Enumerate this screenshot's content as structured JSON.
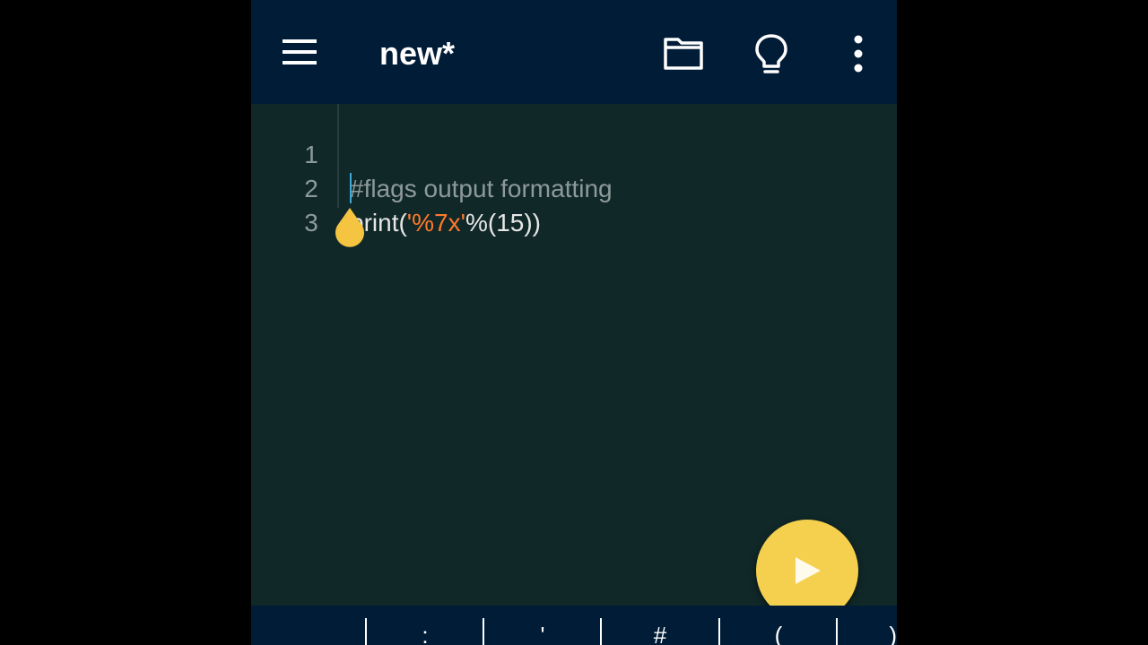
{
  "appbar": {
    "title": "new*",
    "icons": [
      "menu-icon",
      "folder-icon",
      "lightbulb-icon",
      "more-vert-icon"
    ]
  },
  "editor": {
    "lines": [
      {
        "number": "1",
        "text": "#flags output formatting"
      },
      {
        "number": "2",
        "segments": [
          "print(",
          "'%7x'",
          "%(15))"
        ]
      },
      {
        "number": "3",
        "text": ""
      }
    ]
  },
  "fab": {
    "icon": "play-icon"
  },
  "keybar": {
    "keys": [
      "",
      ":",
      "'",
      "#",
      "(",
      ")"
    ]
  },
  "colors": {
    "appbar": "#001c37",
    "editor_bg": "#112828",
    "string": "#ff7a2a",
    "comment": "#8e9a9a",
    "fab": "#f5d04e",
    "cursor": "#3fa7d6"
  }
}
